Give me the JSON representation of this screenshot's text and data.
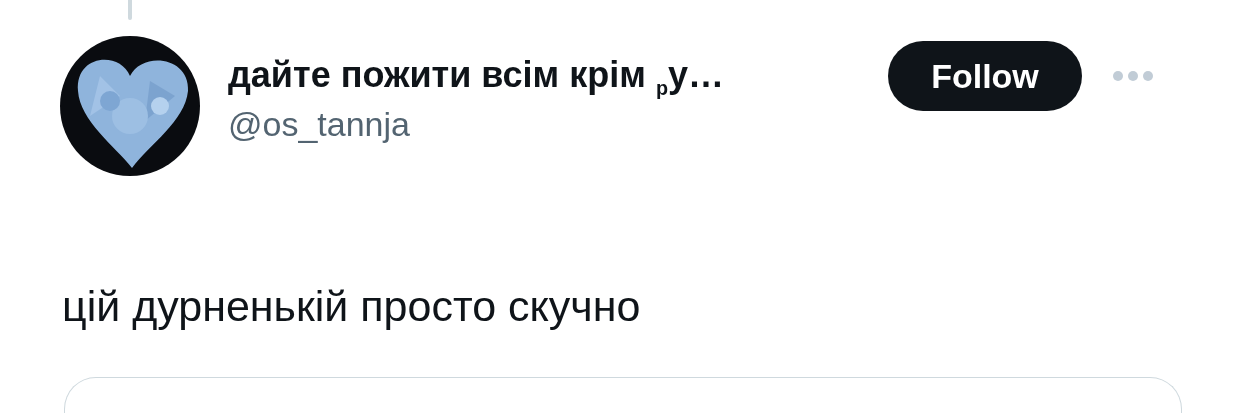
{
  "author": {
    "name": "дайте пожити всім крім $_{р}$у…",
    "handle": "@os_tannja"
  },
  "follow_button": {
    "label": "Follow"
  },
  "tweet": {
    "text": "цій дурненькій просто скучно"
  }
}
